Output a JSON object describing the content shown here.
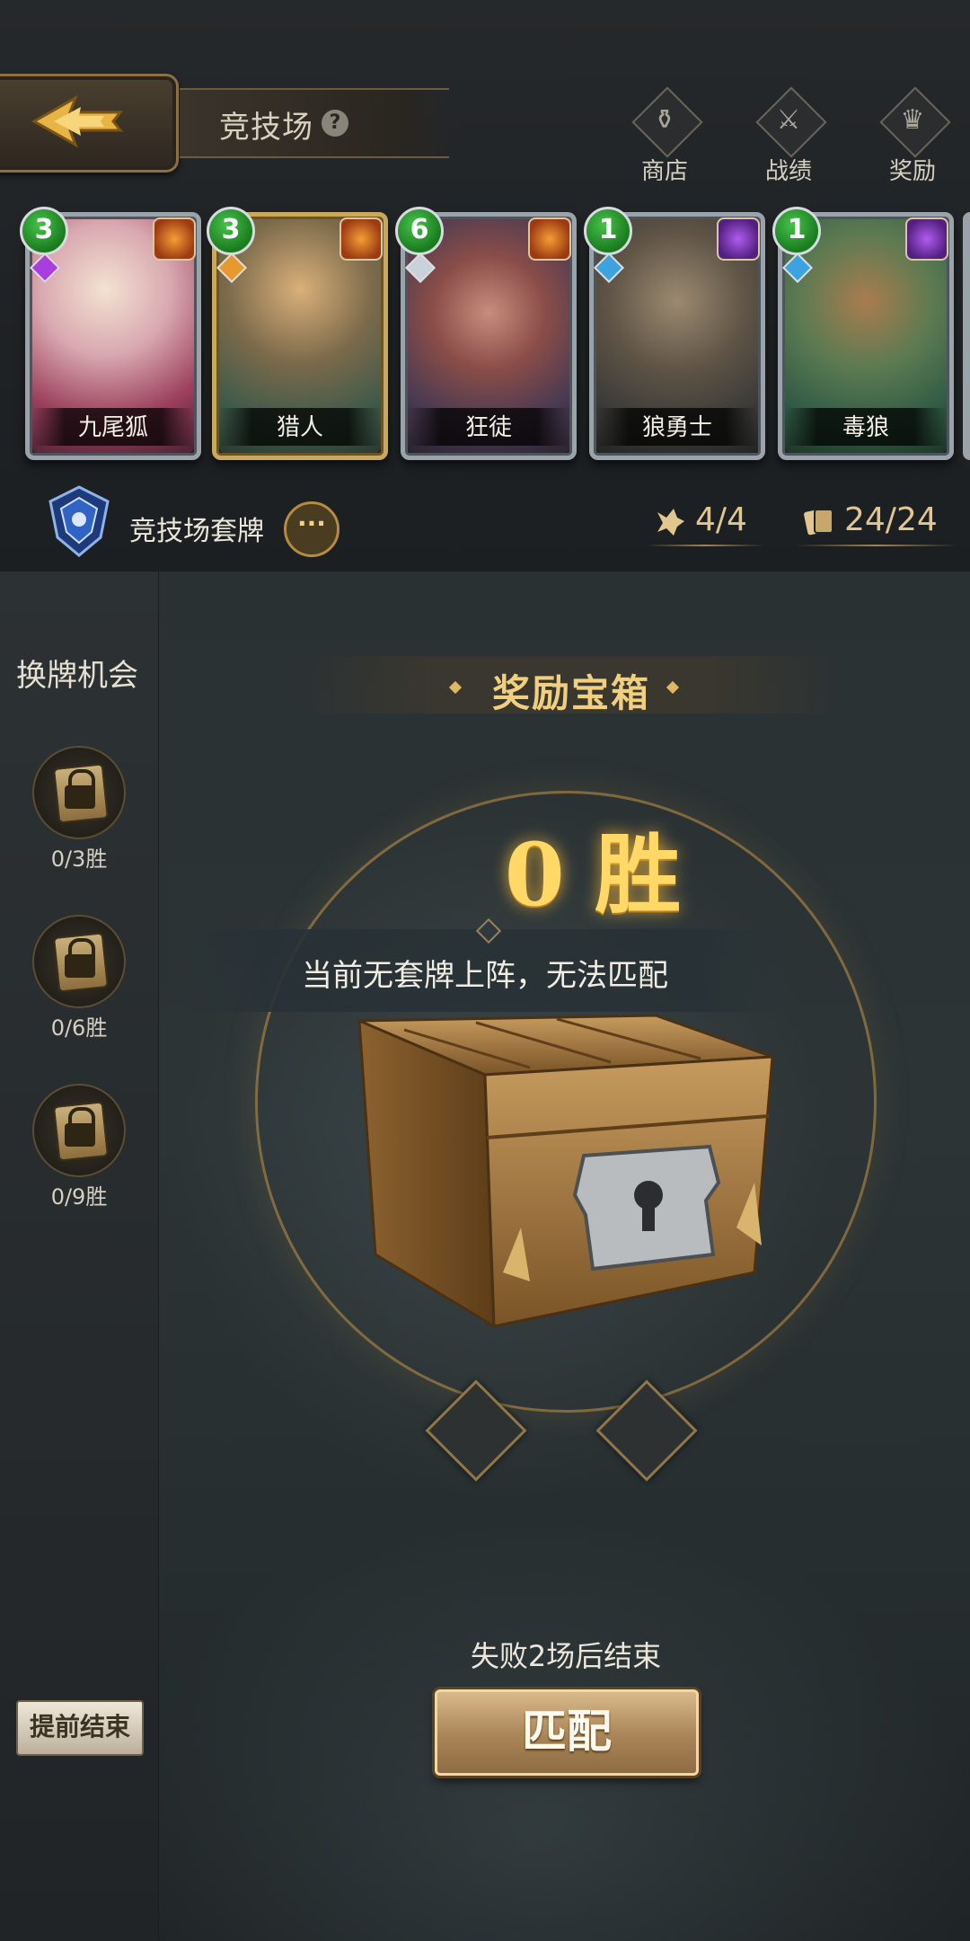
{
  "header": {
    "back_icon": "back-arrow-icon",
    "title": "竞技场",
    "help_icon": "question-icon",
    "nav": [
      {
        "label": "商店",
        "icon": "shop-icon"
      },
      {
        "label": "战绩",
        "icon": "record-icon"
      },
      {
        "label": "奖励",
        "icon": "reward-icon"
      }
    ]
  },
  "cards": [
    {
      "name": "九尾狐",
      "cost": "3",
      "rarity": "purple",
      "class": "sun"
    },
    {
      "name": "猎人",
      "cost": "3",
      "rarity": "orange",
      "class": "sun"
    },
    {
      "name": "狂徒",
      "cost": "6",
      "rarity": "silver",
      "class": "sun"
    },
    {
      "name": "狼勇士",
      "cost": "1",
      "rarity": "blue",
      "class": "beast"
    },
    {
      "name": "毒狼",
      "cost": "1",
      "rarity": "blue",
      "class": "beast"
    }
  ],
  "deck": {
    "name": "竞技场套牌",
    "more": "···",
    "hero_count": "4/4",
    "card_count": "24/24"
  },
  "sidebar": {
    "title": "换牌机会",
    "locks": [
      {
        "label": "0/3胜"
      },
      {
        "label": "0/6胜"
      },
      {
        "label": "0/9胜"
      }
    ],
    "end_button": "提前结束"
  },
  "reward": {
    "title": "奖励宝箱",
    "wins": "0 胜",
    "notice": "当前无套牌上阵，无法匹配",
    "footer": "失败2场后结束",
    "match_button": "匹配"
  },
  "colors": {
    "gold": "#f0cf7e",
    "win_text": "#ffd866",
    "cost_green": "#1a7b1f",
    "class_sun": "#f59e34",
    "class_beast": "#b05cf0"
  }
}
